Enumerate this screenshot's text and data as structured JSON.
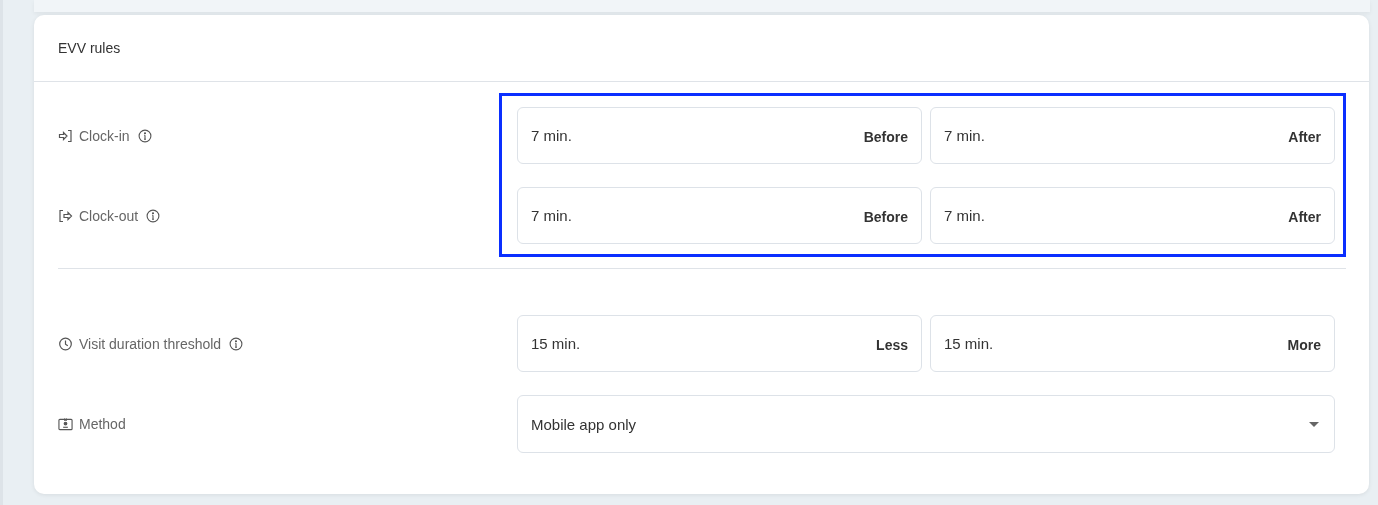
{
  "card": {
    "title": "EVV rules"
  },
  "sections": [
    {
      "highlighted": true,
      "rows": [
        {
          "kind": "clockin",
          "label": "Clock-in",
          "info": true,
          "fields": [
            {
              "value": "7 min.",
              "suffix": "Before"
            },
            {
              "value": "7 min.",
              "suffix": "After"
            }
          ]
        },
        {
          "kind": "clockout",
          "label": "Clock-out",
          "info": true,
          "fields": [
            {
              "value": "7 min.",
              "suffix": "Before"
            },
            {
              "value": "7 min.",
              "suffix": "After"
            }
          ]
        }
      ]
    },
    {
      "highlighted": false,
      "rows": [
        {
          "kind": "duration",
          "label": "Visit duration threshold",
          "info": true,
          "fields": [
            {
              "value": "15 min.",
              "suffix": "Less"
            },
            {
              "value": "15 min.",
              "suffix": "More"
            }
          ]
        },
        {
          "kind": "method",
          "label": "Method",
          "info": false,
          "select": {
            "value": "Mobile app only"
          }
        }
      ]
    }
  ]
}
